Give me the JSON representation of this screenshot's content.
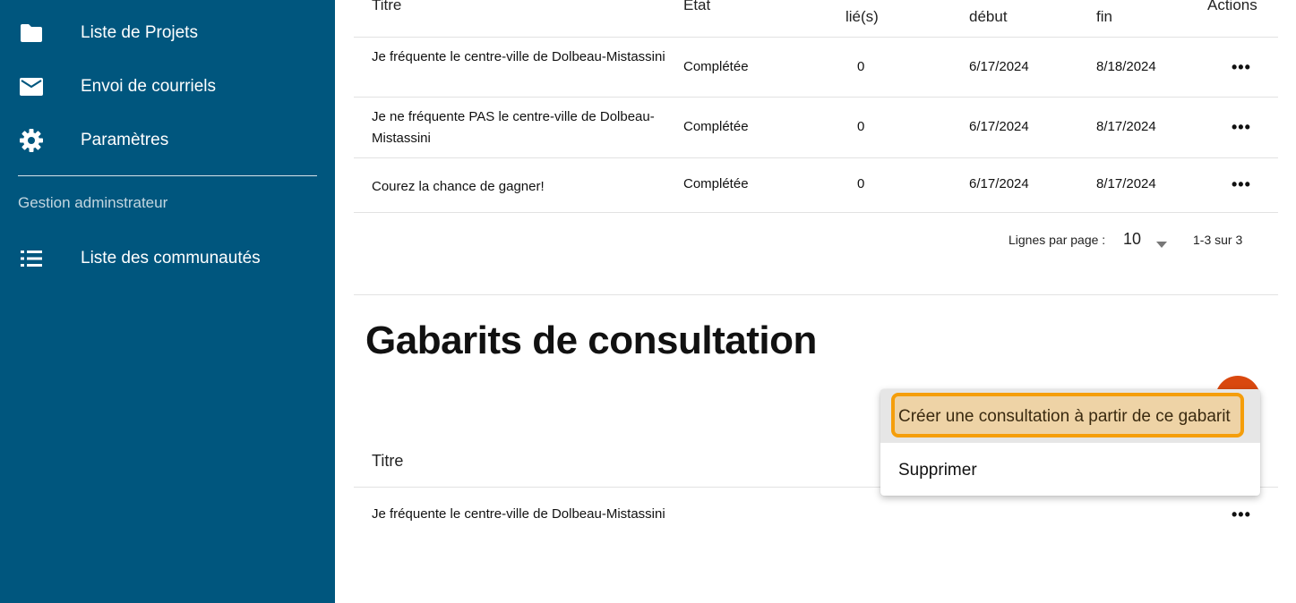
{
  "sidebar": {
    "items": [
      {
        "label": "Liste de Projets",
        "icon": "folder-icon"
      },
      {
        "label": "Envoi de courriels",
        "icon": "mail-icon"
      },
      {
        "label": "Paramètres",
        "icon": "gear-icon"
      }
    ],
    "section_label": "Gestion adminstrateur",
    "admin_items": [
      {
        "label": "Liste des communautés",
        "icon": "list-icon"
      }
    ],
    "bg_color": "#00567e"
  },
  "consultations_table": {
    "headers": {
      "titre": "Titre",
      "etat": "État",
      "lies": "lié(s)",
      "debut": "début",
      "fin": "fin",
      "actions": "Actions"
    },
    "rows": [
      {
        "titre": "Je fréquente le centre-ville de Dolbeau-Mistassini",
        "etat": "Complétée",
        "lies": "0",
        "debut": "6/17/2024",
        "fin": "8/18/2024"
      },
      {
        "titre": "Je ne fréquente PAS le centre-ville de Dolbeau-Mistassini",
        "etat": "Complétée",
        "lies": "0",
        "debut": "6/17/2024",
        "fin": "8/17/2024"
      },
      {
        "titre": "Courez la chance de gagner!",
        "etat": "Complétée",
        "lies": "0",
        "debut": "6/17/2024",
        "fin": "8/17/2024"
      }
    ],
    "pagination": {
      "rows_per_page_label": "Lignes par page :",
      "rows_per_page_value": "10",
      "range": "1-3 sur 3"
    }
  },
  "templates": {
    "title": "Gabarits de consultation",
    "header_titre": "Titre",
    "rows": [
      {
        "titre": "Je fréquente le centre-ville de Dolbeau-Mistassini"
      }
    ]
  },
  "context_menu": {
    "items": [
      {
        "label": "Créer une consultation à partir de ce gabarit"
      },
      {
        "label": "Supprimer"
      }
    ],
    "highlight_color": "#f59e0b"
  },
  "fab": {
    "color": "#d9480f"
  }
}
